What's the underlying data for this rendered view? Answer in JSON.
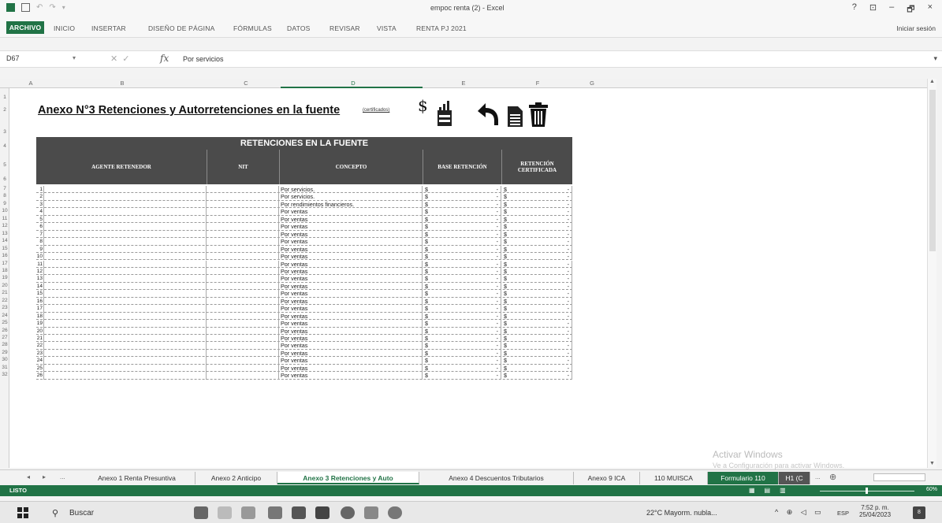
{
  "titlebar": {
    "doc_title": "empoc renta (2) - Excel",
    "help": "?",
    "restore_ribbon": "⊡",
    "minimize": "–",
    "maximize": "🗗",
    "close": "×"
  },
  "ribbon": {
    "tabs": [
      "ARCHIVO",
      "INICIO",
      "INSERTAR",
      "DISEÑO DE PÁGINA",
      "FÓRMULAS",
      "DATOS",
      "REVISAR",
      "VISTA",
      "RENTA PJ 2021"
    ],
    "signin": "Iniciar sesión"
  },
  "formula_bar": {
    "namebox": "D67",
    "fx": "fx",
    "value": "Por servicios"
  },
  "columns": [
    "A",
    "B",
    "C",
    "D",
    "E",
    "F",
    "G"
  ],
  "rows": [
    "1",
    "2",
    "3",
    "4",
    "5",
    "6",
    "7",
    "8",
    "9",
    "10",
    "11",
    "12",
    "13",
    "14",
    "15",
    "16",
    "17",
    "18",
    "19",
    "20",
    "21",
    "22",
    "23",
    "24",
    "25",
    "26",
    "27",
    "28",
    "29",
    "30",
    "31",
    "32"
  ],
  "sheet": {
    "title": "Anexo N°3 Retenciones y Autorretenciones en la fuente",
    "title_note": "(certificados)",
    "logo_pesos": "$",
    "table_title": "RETENCIONES EN LA FUENTE",
    "headers": {
      "agente": "AGENTE RETENEDOR",
      "nit": "NIT",
      "concepto": "CONCEPTO",
      "base": "BASE RETENCIÓN",
      "retencion_1": "RETENCIÓN",
      "retencion_2": "CERTIFICADA"
    },
    "currency_symbol": "$",
    "empty_value": "-",
    "entries": [
      {
        "n": "1",
        "concepto": "Por servicios."
      },
      {
        "n": "2",
        "concepto": "Por servicios."
      },
      {
        "n": "3",
        "concepto": "Por rendimientos financieros."
      },
      {
        "n": "4",
        "concepto": "Por ventas"
      },
      {
        "n": "5",
        "concepto": "Por ventas"
      },
      {
        "n": "6",
        "concepto": "Por ventas"
      },
      {
        "n": "7",
        "concepto": "Por ventas"
      },
      {
        "n": "8",
        "concepto": "Por ventas"
      },
      {
        "n": "9",
        "concepto": "Por ventas"
      },
      {
        "n": "10",
        "concepto": "Por ventas"
      },
      {
        "n": "11",
        "concepto": "Por ventas"
      },
      {
        "n": "12",
        "concepto": "Por ventas"
      },
      {
        "n": "13",
        "concepto": "Por ventas"
      },
      {
        "n": "14",
        "concepto": "Por ventas"
      },
      {
        "n": "15",
        "concepto": "Por ventas"
      },
      {
        "n": "16",
        "concepto": "Por ventas"
      },
      {
        "n": "17",
        "concepto": "Por ventas"
      },
      {
        "n": "18",
        "concepto": "Por ventas"
      },
      {
        "n": "19",
        "concepto": "Por ventas"
      },
      {
        "n": "20",
        "concepto": "Por ventas"
      },
      {
        "n": "21",
        "concepto": "Por ventas"
      },
      {
        "n": "22",
        "concepto": "Por ventas"
      },
      {
        "n": "23",
        "concepto": "Por ventas"
      },
      {
        "n": "24",
        "concepto": "Por ventas"
      },
      {
        "n": "25",
        "concepto": "Por ventas"
      },
      {
        "n": "26",
        "concepto": "Por ventas"
      }
    ]
  },
  "watermark": {
    "line1": "Activar Windows",
    "line2": "Ve a Configuración para activar Windows."
  },
  "sheet_tabs": {
    "nav_prev": "◂",
    "nav_next": "▸",
    "ellipsis": "...",
    "tabs": [
      "Anexo 1 Renta Presuntiva",
      "Anexo 2 Anticipo",
      "Anexo 3 Retenciones y Auto",
      "Anexo 4 Descuentos Tributarios",
      "Anexo 9 ICA",
      "110 MUISCA",
      "Formulario 110",
      "H1 (C"
    ],
    "more": "...",
    "add": "⊕"
  },
  "statusbar": {
    "status": "LISTO",
    "zoom": "60%"
  },
  "taskbar": {
    "search": "Buscar",
    "weather": "22°C  Mayorm. nubla...",
    "lang": "ESP",
    "time": "7:52 p. m.",
    "date": "25/04/2023",
    "notifications": "8"
  }
}
